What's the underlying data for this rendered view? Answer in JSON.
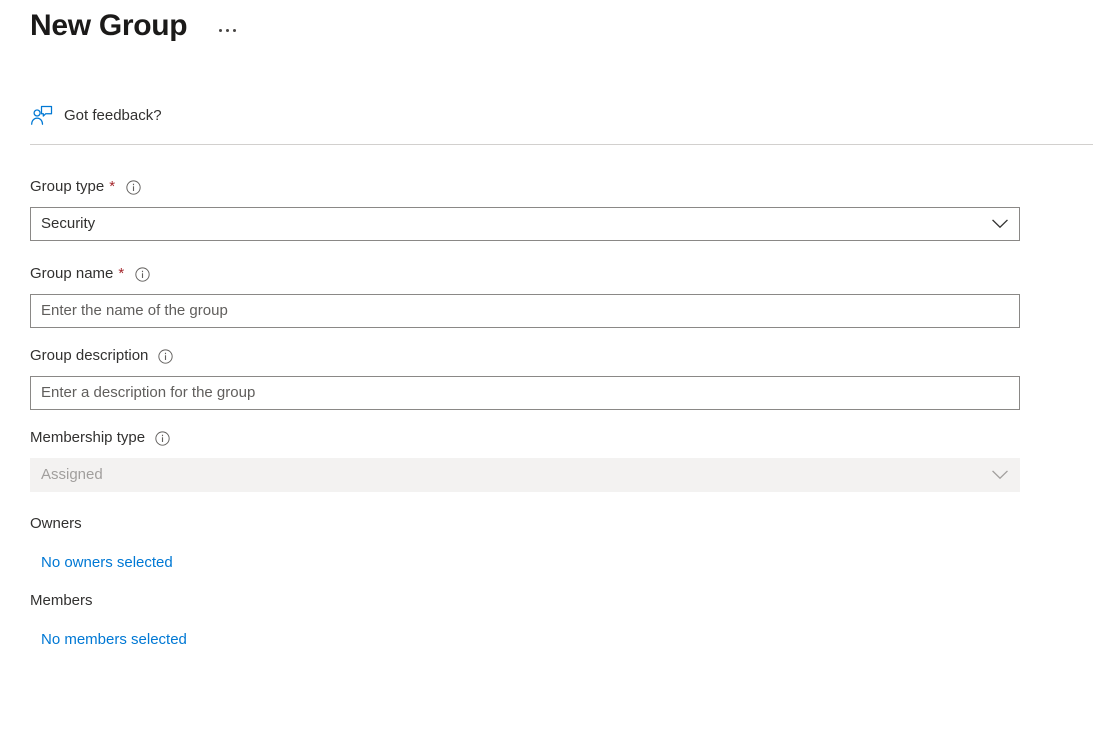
{
  "header": {
    "title": "New Group",
    "overflow_menu": "…"
  },
  "command_bar": {
    "feedback": {
      "icon": "feedback-person-icon",
      "label": "Got feedback?"
    }
  },
  "form": {
    "fields": [
      {
        "name": "group-type",
        "label": "Group type",
        "required": true,
        "required_marker": "*",
        "info_icon": "info-icon",
        "control": "dropdown",
        "value": "Security",
        "disabled": false
      },
      {
        "name": "group-name",
        "label": "Group name",
        "required": true,
        "required_marker": "*",
        "info_icon": "info-icon",
        "control": "textbox",
        "value": "",
        "placeholder": "Enter the name of the group",
        "disabled": false
      },
      {
        "name": "group-description",
        "label": "Group description",
        "required": false,
        "info_icon": "info-icon",
        "control": "textbox",
        "value": "",
        "placeholder": "Enter a description for the group",
        "disabled": false
      },
      {
        "name": "membership-type",
        "label": "Membership type",
        "required": false,
        "info_icon": "info-icon",
        "control": "dropdown",
        "value": "Assigned",
        "disabled": true
      }
    ],
    "people_sections": [
      {
        "name": "owners",
        "label": "Owners",
        "link_text": "No owners selected"
      },
      {
        "name": "members",
        "label": "Members",
        "link_text": "No members selected"
      }
    ]
  },
  "colors": {
    "accent_link": "#0078d4",
    "required_star": "#a4262c",
    "text_primary": "#323130",
    "placeholder": "#605e5c",
    "border": "#8a8886",
    "disabled_bg": "#f3f2f1",
    "disabled_text": "#a19f9d",
    "divider": "#d2d0ce"
  }
}
